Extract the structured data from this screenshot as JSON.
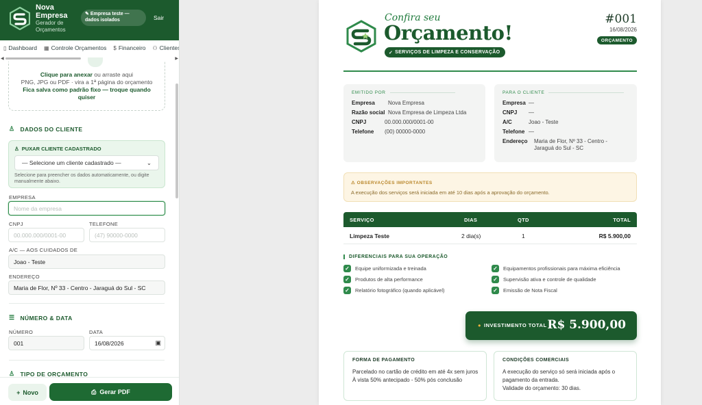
{
  "brand": {
    "name": "Nova Empresa",
    "subtitle": "Gerador de Orçamentos"
  },
  "header": {
    "tenant_pill": "Empresa teste — dados isolados",
    "logout": "Sair"
  },
  "nav": {
    "tabs": [
      "Dashboard",
      "Controle Orçamentos",
      "Financeiro",
      "Clientes"
    ]
  },
  "upload": {
    "link": "Clique para anexar",
    "rest": "ou arraste aqui",
    "line2": "PNG, JPG ou PDF · vira a 1ª página do orçamento",
    "line3": "Fica salva como padrão fixo — troque quando quiser"
  },
  "client_section": {
    "title": "DADOS DO CLIENTE",
    "pull_title": "PUXAR CLIENTE CADASTRADO",
    "select_value": "— Selecione um cliente cadastrado —",
    "pull_help": "Selecione para preencher os dados automaticamente, ou digite manualmente abaixo.",
    "empresa_label": "EMPRESA",
    "empresa_placeholder": "Nome da empresa",
    "cnpj_label": "CNPJ",
    "cnpj_placeholder": "00.000.000/0001-00",
    "telefone_label": "TELEFONE",
    "telefone_placeholder": "(47) 90000-0000",
    "ac_label": "A/C — AOS CUIDADOS DE",
    "ac_value": "Joao - Teste",
    "endereco_label": "ENDEREÇO",
    "endereco_value": "Maria de Flor, Nº 33 - Centro - Jaraguá do Sul - SC"
  },
  "number_section": {
    "title": "NÚMERO & DATA",
    "numero_label": "NÚMERO",
    "numero_value": "001",
    "data_label": "DATA",
    "data_value": "16/08/2026"
  },
  "type_section": {
    "title": "TIPO DE ORÇAMENTO"
  },
  "bottom": {
    "novo": "Novo",
    "gerar_pdf": "Gerar PDF"
  },
  "doc": {
    "confira": "Confira seu",
    "title": "Orçamento!",
    "subpill": "SERVIÇOS DE LIMPEZA E CONSERVAÇÃO",
    "numero": "#001",
    "date": "16/08/2026",
    "badge": "ORÇAMENTO",
    "emitido": {
      "title": "EMITIDO POR",
      "rows": [
        {
          "k": "Empresa",
          "v": "Nova Empresa"
        },
        {
          "k": "Razão social",
          "v": "Nova Empresa de Limpeza Ltda"
        },
        {
          "k": "CNPJ",
          "v": "00.000.000/0001-00"
        },
        {
          "k": "Telefone",
          "v": "(00) 00000-0000"
        }
      ]
    },
    "cliente": {
      "title": "PARA O CLIENTE",
      "rows": [
        {
          "k": "Empresa",
          "v": "—"
        },
        {
          "k": "CNPJ",
          "v": "—"
        },
        {
          "k": "A/C",
          "v": "Joao - Teste"
        },
        {
          "k": "Telefone",
          "v": "—"
        },
        {
          "k": "Endereço",
          "v": "Maria de Flor, Nº 33 - Centro - Jaraguá do Sul - SC"
        }
      ]
    },
    "alert": {
      "title": "OBSERVAÇÕES IMPORTANTES",
      "body": "A execução dos serviços será iniciada em até 10 dias após a aprovação do orçamento."
    },
    "table": {
      "headers": [
        "SERVIÇO",
        "DIAS",
        "QTD",
        "TOTAL"
      ],
      "rows": [
        {
          "servico": "Limpeza Teste",
          "dias": "2 dia(s)",
          "qtd": "1",
          "total": "R$ 5.900,00"
        }
      ]
    },
    "diferenciais": {
      "title": "DIFERENCIAIS PARA SUA OPERAÇÃO",
      "items": [
        "Equipe uniformizada e treinada",
        "Equipamentos profissionais para máxima eficiência",
        "Produtos de alta performance",
        "Supervisão ativa e controle de qualidade",
        "Relatório fotográfico (quando aplicável)",
        "Emissão de Nota Fiscal"
      ]
    },
    "investimento": {
      "label": "INVESTIMENTO TOTAL",
      "value": "R$ 5.900,00"
    },
    "pagamento": {
      "title": "FORMA DE PAGAMENTO",
      "line1": "Parcelado no cartão de crédito em até 4x sem juros",
      "line2": "À vista 50% antecipado - 50% pós conclusão"
    },
    "condicoes": {
      "title": "CONDIÇÕES COMERCIAIS",
      "line1": "A execução do serviço só será iniciada após o pagamento da entrada.",
      "line2": "Validade do orçamento: 30 dias."
    }
  },
  "colors": {
    "primary": "#1c5a2d",
    "accent": "#2f8a4b",
    "alert_bg": "#fdf5e4"
  }
}
